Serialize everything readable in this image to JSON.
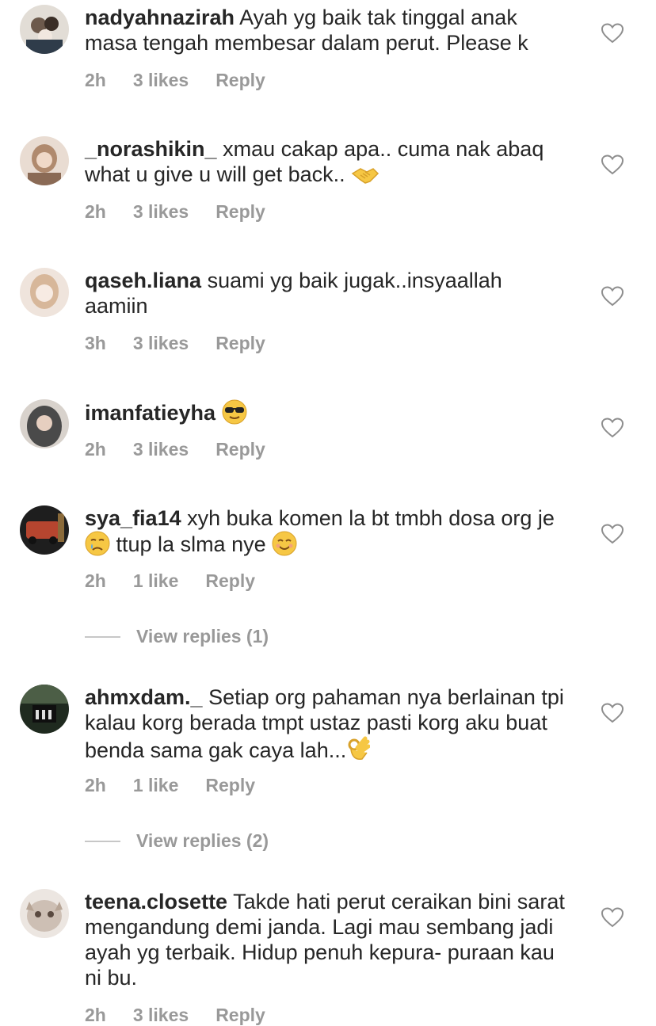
{
  "comments": [
    {
      "user": "nadyahnazirah",
      "text": "Ayah yg baik tak tinggal anak masa tengah membesar dalam perut. Please k",
      "time": "2h",
      "likes": "3 likes",
      "reply": "Reply",
      "avatar_colors": [
        "#6d5a4c",
        "#d9c8b8"
      ]
    },
    {
      "user": "_norashikin_",
      "text": "xmau cakap apa.. cuma nak abaq what u give u will get back..",
      "emoji": "handshake-emoji",
      "time": "2h",
      "likes": "3 likes",
      "reply": "Reply",
      "avatar_colors": [
        "#b08a6e",
        "#e9d6c8"
      ]
    },
    {
      "user": "qaseh.liana",
      "text": "suami yg baik jugak..insyaallah aamiin",
      "time": "3h",
      "likes": "3 likes",
      "reply": "Reply",
      "avatar_colors": [
        "#d7b79a",
        "#f4e7df"
      ]
    },
    {
      "user": "imanfatieyha",
      "text": "",
      "emoji": "sunglasses-emoji",
      "time": "2h",
      "likes": "3 likes",
      "reply": "Reply",
      "avatar_colors": [
        "#4a4a4a",
        "#c9b3a5"
      ]
    },
    {
      "user": "sya_fia14",
      "text": "xyh buka komen la bt tmbh dosa org je",
      "text2": "ttup la slma nye",
      "time": "2h",
      "likes": "1 like",
      "reply": "Reply",
      "avatar_colors": [
        "#2b2b2b",
        "#b6452f"
      ]
    },
    {
      "user": "ahmxdam._",
      "text": "Setiap org pahaman nya berlainan tpi kalau korg berada tmpt ustaz pasti korg aku buat benda sama gak  caya lah...",
      "emoji": "ok-hand-emoji",
      "time": "2h",
      "likes": "1 like",
      "reply": "Reply",
      "avatar_colors": [
        "#1f2a1f",
        "#7c8f73"
      ]
    },
    {
      "user": "teena.closette",
      "text": "Takde hati perut ceraikan bini sarat mengandung demi janda. Lagi mau sembang jadi ayah yg terbaik. Hidup penuh kepura- puraan kau ni bu.",
      "time": "2h",
      "likes": "3 likes",
      "reply": "Reply",
      "avatar_colors": [
        "#cdbfb4",
        "#efe6df"
      ]
    }
  ],
  "view_replies": [
    {
      "label": "View replies (1)"
    },
    {
      "label": "View replies (2)"
    }
  ]
}
